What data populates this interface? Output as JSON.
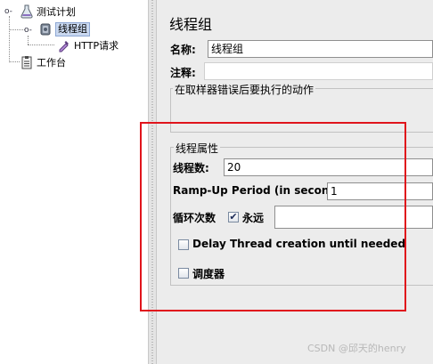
{
  "tree": {
    "test_plan": "测试计划",
    "thread_group": "线程组",
    "http_request": "HTTP请求",
    "workbench": "工作台"
  },
  "panel": {
    "title": "线程组",
    "name_label": "名称:",
    "name_value": "线程组",
    "comment_label": "注释:",
    "error_action_label": "在取样器错误后要执行的动作",
    "thread_props_label": "线程属性",
    "threads_label": "线程数:",
    "threads_value": "20",
    "rampup_label": "Ramp-Up Period (in seconds):",
    "rampup_value": "1",
    "loop_label": "循环次数",
    "forever_label": "永远",
    "forever_checked": true,
    "delay_label": "Delay Thread creation until needed",
    "delay_checked": false,
    "scheduler_label": "调度器",
    "scheduler_checked": false
  },
  "watermark": "CSDN @邱天的henry",
  "colors": {
    "highlight_border": "#e0141c",
    "selection": "#c9d8f0"
  }
}
